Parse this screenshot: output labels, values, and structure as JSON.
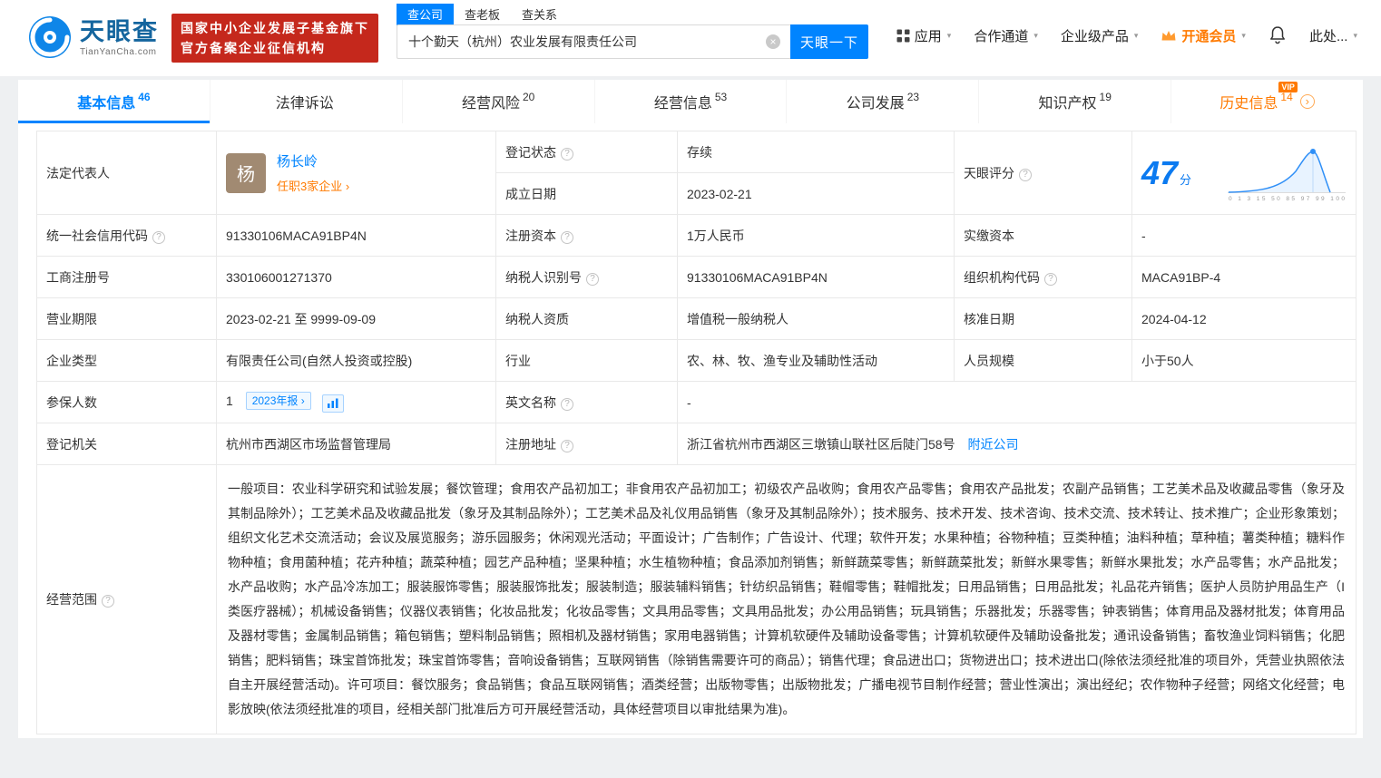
{
  "colors": {
    "accent_blue": "#0084ff",
    "brand_red": "#c5281c",
    "vip_orange": "#ff7a00",
    "status_green": "#00ab46"
  },
  "icons": {
    "caret": "▾",
    "clear": "×",
    "help": "?",
    "arrow": "›"
  },
  "header": {
    "logo": {
      "brand": "天眼查",
      "sub": "TianYanCha.com"
    },
    "badge": {
      "line1": "国家中小企业发展子基金旗下",
      "line2": "官方备案企业征信机构"
    },
    "search": {
      "tabs": [
        {
          "label": "查公司"
        },
        {
          "label": "查老板"
        },
        {
          "label": "查关系"
        }
      ],
      "value": "十个勤天（杭州）农业发展有限责任公司",
      "button": "天眼一下"
    },
    "nav": {
      "apps": "应用",
      "cooperation": "合作通道",
      "enterprise": "企业级产品",
      "vip": "开通会员",
      "more": "此处..."
    }
  },
  "tabs": [
    {
      "label": "基本信息",
      "count": "46"
    },
    {
      "label": "法律诉讼",
      "count": ""
    },
    {
      "label": "经营风险",
      "count": "20"
    },
    {
      "label": "经营信息",
      "count": "53"
    },
    {
      "label": "公司发展",
      "count": "23"
    },
    {
      "label": "知识产权",
      "count": "19"
    },
    {
      "label": "历史信息",
      "count": "14",
      "vip": "VIP"
    }
  ],
  "score": {
    "label": "天眼评分",
    "value": "47",
    "unit": "分",
    "axis": "0 1 3 15 50 85 97 99 100"
  },
  "fields": {
    "legal_rep": {
      "label": "法定代表人",
      "avatar": "杨",
      "name": "杨长岭",
      "link": "任职3家企业 ›"
    },
    "reg_status": {
      "label": "登记状态",
      "value": "存续"
    },
    "est_date": {
      "label": "成立日期",
      "value": "2023-02-21"
    },
    "credit_code": {
      "label": "统一社会信用代码",
      "value": "91330106MACA91BP4N"
    },
    "reg_capital": {
      "label": "注册资本",
      "value": "1万人民币"
    },
    "paid_capital": {
      "label": "实缴资本",
      "value": "-"
    },
    "reg_no": {
      "label": "工商注册号",
      "value": "330106001271370"
    },
    "taxpayer_id": {
      "label": "纳税人识别号",
      "value": "91330106MACA91BP4N"
    },
    "org_code": {
      "label": "组织机构代码",
      "value": "MACA91BP-4"
    },
    "term": {
      "label": "营业期限",
      "value": "2023-02-21 至 9999-09-09"
    },
    "taxpayer_qual": {
      "label": "纳税人资质",
      "value": "增值税一般纳税人"
    },
    "approve_date": {
      "label": "核准日期",
      "value": "2024-04-12"
    },
    "ent_type": {
      "label": "企业类型",
      "value": "有限责任公司(自然人投资或控股)"
    },
    "industry": {
      "label": "行业",
      "value": "农、林、牧、渔专业及辅助性活动"
    },
    "staff": {
      "label": "人员规模",
      "value": "小于50人"
    },
    "insured": {
      "label": "参保人数",
      "value": "1",
      "tag": "2023年报 ›"
    },
    "en_name": {
      "label": "英文名称",
      "value": "-"
    },
    "authority": {
      "label": "登记机关",
      "value": "杭州市西湖区市场监督管理局"
    },
    "address": {
      "label": "注册地址",
      "value": "浙江省杭州市西湖区三墩镇山联社区后陡门58号",
      "link": "附近公司"
    },
    "scope": {
      "label": "经营范围",
      "value": "一般项目：农业科学研究和试验发展；餐饮管理；食用农产品初加工；非食用农产品初加工；初级农产品收购；食用农产品零售；食用农产品批发；农副产品销售；工艺美术品及收藏品零售（象牙及其制品除外）；工艺美术品及收藏品批发（象牙及其制品除外）；工艺美术品及礼仪用品销售（象牙及其制品除外）；技术服务、技术开发、技术咨询、技术交流、技术转让、技术推广；企业形象策划；组织文化艺术交流活动；会议及展览服务；游乐园服务；休闲观光活动；平面设计；广告制作；广告设计、代理；软件开发；水果种植；谷物种植；豆类种植；油料种植；草种植；薯类种植；糖料作物种植；食用菌种植；花卉种植；蔬菜种植；园艺产品种植；坚果种植；水生植物种植；食品添加剂销售；新鲜蔬菜零售；新鲜蔬菜批发；新鲜水果零售；新鲜水果批发；水产品零售；水产品批发；水产品收购；水产品冷冻加工；服装服饰零售；服装服饰批发；服装制造；服装辅料销售；针纺织品销售；鞋帽零售；鞋帽批发；日用品销售；日用品批发；礼品花卉销售；医护人员防护用品生产（I类医疗器械）；机械设备销售；仪器仪表销售；化妆品批发；化妆品零售；文具用品零售；文具用品批发；办公用品销售；玩具销售；乐器批发；乐器零售；钟表销售；体育用品及器材批发；体育用品及器材零售；金属制品销售；箱包销售；塑料制品销售；照相机及器材销售；家用电器销售；计算机软硬件及辅助设备零售；计算机软硬件及辅助设备批发；通讯设备销售；畜牧渔业饲料销售；化肥销售；肥料销售；珠宝首饰批发；珠宝首饰零售；音响设备销售；互联网销售（除销售需要许可的商品）；销售代理；食品进出口；货物进出口；技术进出口(除依法须经批准的项目外，凭营业执照依法自主开展经营活动)。许可项目：餐饮服务；食品销售；食品互联网销售；酒类经营；出版物零售；出版物批发；广播电视节目制作经营；营业性演出；演出经纪；农作物种子经营；网络文化经营；电影放映(依法须经批准的项目，经相关部门批准后方可开展经营活动，具体经营项目以审批结果为准)。"
    }
  }
}
